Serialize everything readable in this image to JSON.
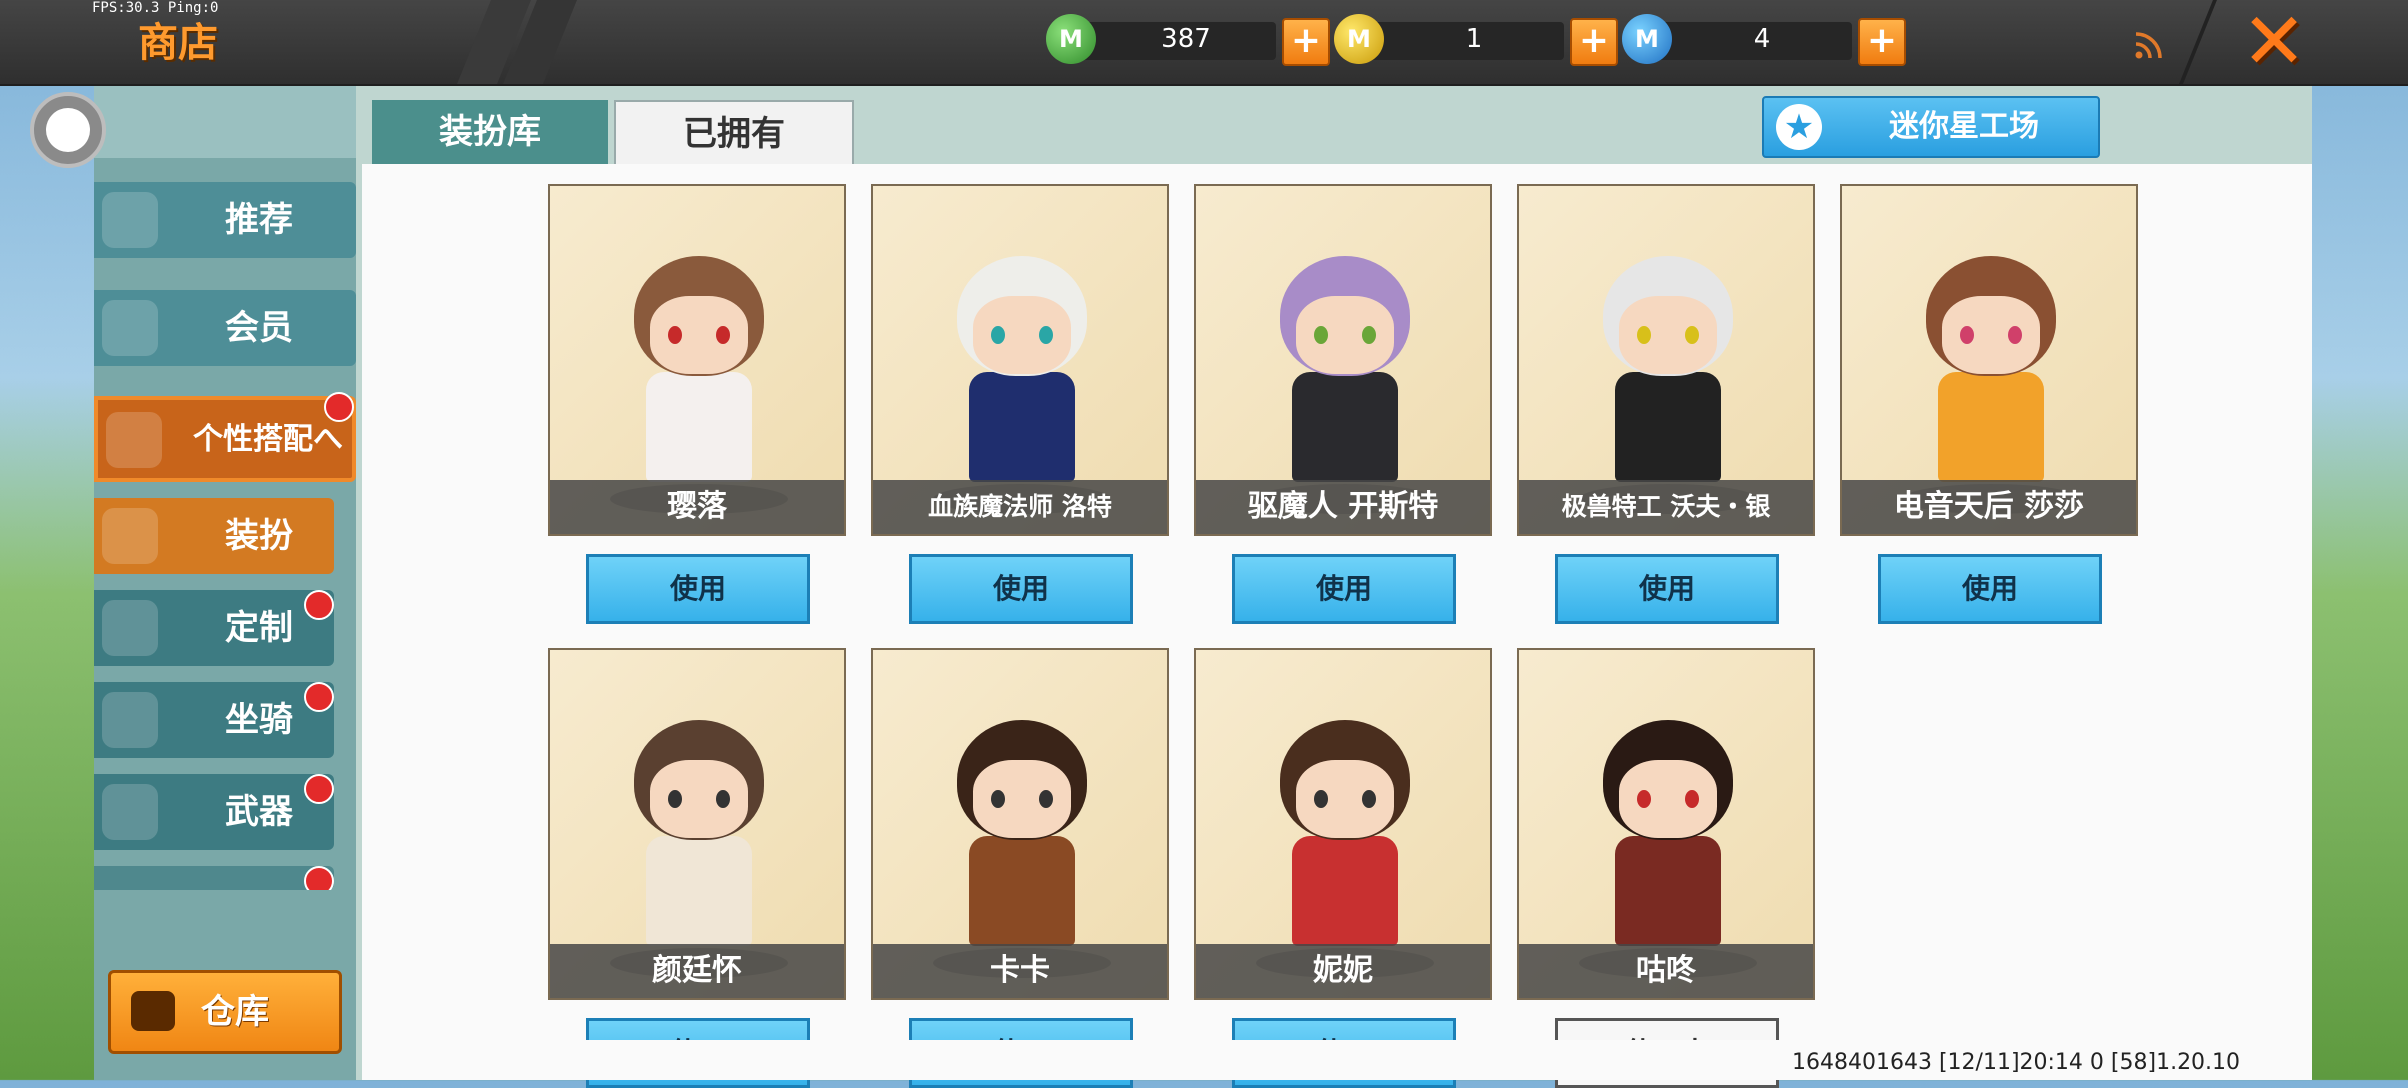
{
  "hud": {
    "fps": "FPS:30.3  Ping:0"
  },
  "header": {
    "title": "商店"
  },
  "currencies": [
    {
      "icon": "green-gem-coin-icon",
      "glyph": "M",
      "value": "387",
      "color": "#3fa23a"
    },
    {
      "icon": "gold-coin-icon",
      "glyph": "M",
      "value": "1",
      "color": "#e2b80f"
    },
    {
      "icon": "blue-coin-icon",
      "glyph": "M",
      "value": "4",
      "color": "#2d8ee0"
    }
  ],
  "sidebar": {
    "items": [
      {
        "label": "推荐",
        "icon": "thumbs-up-icon"
      },
      {
        "label": "会员",
        "icon": "vip-icon"
      },
      {
        "label": "个性搭配へ",
        "icon": "trophy-icon"
      },
      {
        "label": "装扮",
        "icon": "shirt-icon"
      },
      {
        "label": "定制",
        "icon": "pencil-icon"
      },
      {
        "label": "坐骑",
        "icon": "mount-icon"
      },
      {
        "label": "武器",
        "icon": "gun-icon"
      }
    ],
    "warehouse_label": "仓库"
  },
  "tabs": [
    {
      "label": "装扮库"
    },
    {
      "label": "已拥有"
    }
  ],
  "mini_button": {
    "label": "迷你星工场"
  },
  "costumes": [
    {
      "name": "璎落",
      "button": "使用",
      "hair": "#8a5a3c",
      "outfit": "#f4f0ee",
      "eyes": "#c62a2a"
    },
    {
      "name": "血族魔法师 洛特",
      "button": "使用",
      "hair": "#eeeeea",
      "outfit": "#1f2e6e",
      "eyes": "#2aa6a6"
    },
    {
      "name": "驱魔人 开斯特",
      "button": "使用",
      "hair": "#a88cc8",
      "outfit": "#2a2a2e",
      "eyes": "#6aa638"
    },
    {
      "name": "极兽特工 沃夫・银",
      "button": "使用",
      "hair": "#e6e6e6",
      "outfit": "#222222",
      "eyes": "#d8c01a"
    },
    {
      "name": "电音天后 莎莎",
      "button": "使用",
      "hair": "#8a5032",
      "outfit": "#f2a22a",
      "eyes": "#d0406a"
    },
    {
      "name": "颜廷怀",
      "button": "使用",
      "hair": "#5a4030",
      "outfit": "#f0e6d6",
      "eyes": "#333333"
    },
    {
      "name": "卡卡",
      "button": "使用",
      "hair": "#3a2418",
      "outfit": "#8a4a24",
      "eyes": "#333333"
    },
    {
      "name": "妮妮",
      "button": "使用",
      "hair": "#4a2e1e",
      "outfit": "#c83030",
      "eyes": "#333333"
    },
    {
      "name": "咕咚",
      "button": "使用中",
      "hair": "#2a1a14",
      "outfit": "#7a2a22",
      "eyes": "#c62a2a"
    }
  ],
  "footer": {
    "text": "1648401643   [12/11]20:14 0    [58]1.20.10"
  }
}
